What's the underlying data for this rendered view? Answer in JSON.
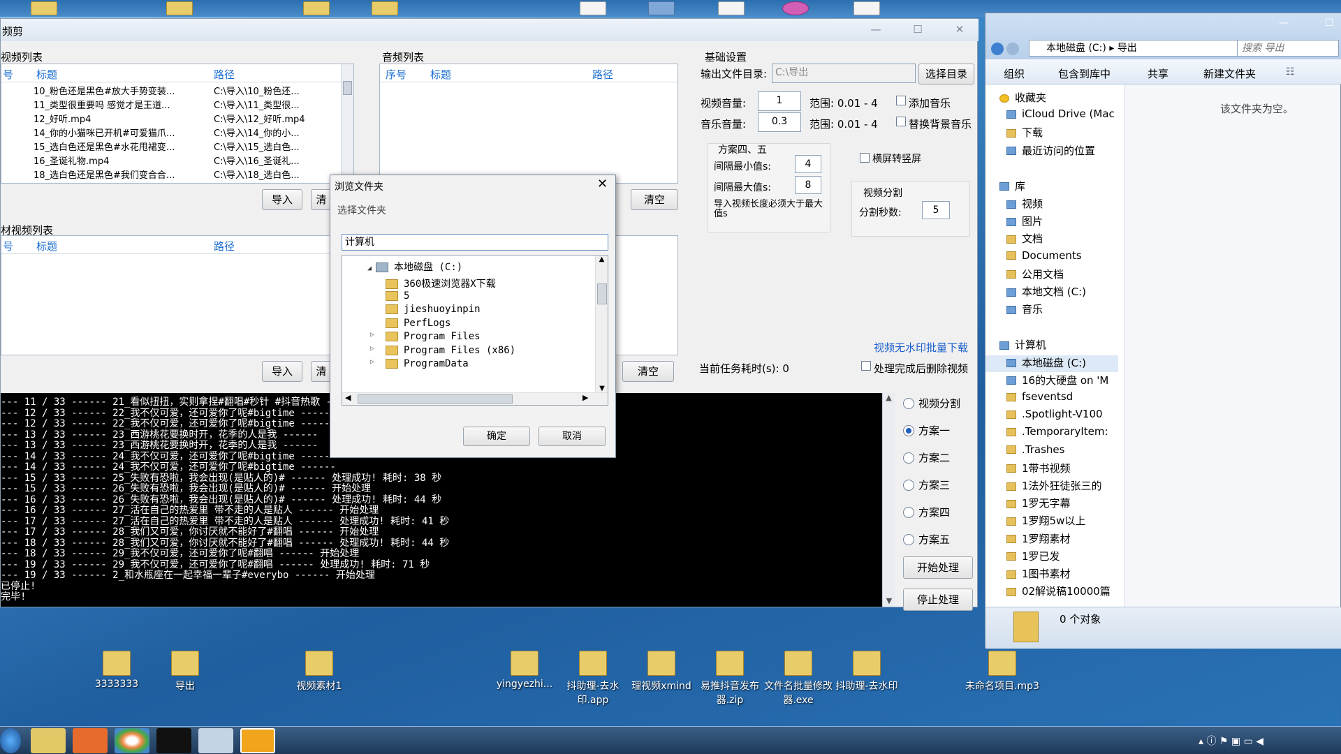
{
  "app": {
    "title": "频剪",
    "video_list": {
      "title": "视频列表",
      "cols": [
        "号",
        "标题",
        "路径"
      ],
      "rows": [
        {
          "title": "10_粉色还是黑色#放大手势变装...",
          "path": "C:\\导入\\10_粉色还..."
        },
        {
          "title": "11_类型很重要吗 感觉才是王道...",
          "path": "C:\\导入\\11_类型很..."
        },
        {
          "title": "12_好听.mp4",
          "path": "C:\\导入\\12_好听.mp4"
        },
        {
          "title": "14_你的小猫咪已开机#可爱猫爪...",
          "path": "C:\\导入\\14_你的小..."
        },
        {
          "title": "15_选白色还是黑色#水花甩裙变...",
          "path": "C:\\导入\\15_选白色..."
        },
        {
          "title": "16_圣诞礼物.mp4",
          "path": "C:\\导入\\16_圣诞礼..."
        },
        {
          "title": "18_选白色还是黑色#我们变合合...",
          "path": "C:\\导入\\18_选白色..."
        }
      ]
    },
    "audio_list": {
      "title": "音频列表",
      "cols": [
        "序号",
        "标题",
        "路径"
      ]
    },
    "material_list": {
      "title": "材视频列表",
      "cols": [
        "号",
        "标题",
        "路径"
      ]
    },
    "buttons": {
      "import": "导入",
      "clear": "清",
      "clear_full": "清空",
      "start": "开始处理",
      "stop": "停止处理",
      "choose_dir": "选择目录"
    },
    "settings": {
      "title": "基础设置",
      "output_label": "输出文件目录:",
      "output_value": "C:\\导出",
      "video_vol_label": "视频音量:",
      "video_vol": "1",
      "range1": "范围: 0.01 - 4",
      "add_music": "添加音乐",
      "music_vol_label": "音乐音量:",
      "music_vol": "0.3",
      "range2": "范围: 0.01 - 4",
      "replace_bg": "替换背景音乐",
      "plan45": "方案四、五",
      "min_label": "间隔最小值s:",
      "min_val": "4",
      "max_label": "间隔最大值s:",
      "max_val": "8",
      "note": "导入视频长度必须大于最大值s",
      "landscape": "横屏转竖屏",
      "split_title": "视频分割",
      "split_label": "分割秒数:",
      "split_val": "5",
      "link": "视频无水印批量下载",
      "elapsed": "当前任务耗时(s): 0",
      "delete_after": "处理完成后删除视频"
    },
    "modes": [
      "视频分割",
      "方案一",
      "方案二",
      "方案三",
      "方案四",
      "方案五"
    ],
    "selected_mode": "方案一",
    "console": [
      "--- 11 / 33 ------ 21_看似扭扭，实则拿捏#翻唱#秒针 #抖音热歌 ------",
      "--- 12 / 33 ------ 22_我不仅可爱，还可爱你了呢#bigtime ------",
      "--- 12 / 33 ------ 22_我不仅可爱，还可爱你了呢#bigtime ------",
      "--- 13 / 33 ------ 23_西游桃花要换时开，花季的人是我 ------",
      "--- 13 / 33 ------ 23_西游桃花要换时开，花季的人是我 ------",
      "--- 14 / 33 ------ 24_我不仅可爱，还可爱你了呢#bigtime ------",
      "--- 14 / 33 ------ 24_我不仅可爱，还可爱你了呢#bigtime ------",
      "--- 15 / 33 ------ 25_失败有恐啦，我会出现(是贴人的)# ------ 处理成功!  耗时: 38 秒",
      "--- 15 / 33 ------ 26_失败有恐啦，我会出现(是贴人的)# ------ 开始处理",
      "--- 16 / 33 ------ 26_失败有恐啦，我会出现(是贴人的)# ------ 处理成功!  耗时: 44 秒",
      "--- 16 / 33 ------ 27_活在自己的热爱里 带不走的人是贴人 ------ 开始处理",
      "--- 17 / 33 ------ 27_活在自己的热爱里 带不走的人是贴人 ------ 处理成功!  耗时: 41 秒",
      "--- 17 / 33 ------ 28_我们又可爱，你讨厌就不能好了#翻唱 ------ 开始处理",
      "--- 18 / 33 ------ 28_我们又可爱，你讨厌就不能好了#翻唱 ------ 处理成功!  耗时: 44 秒",
      "--- 18 / 33 ------ 29_我不仅可爱，还可爱你了呢#翻唱 ------ 开始处理",
      "--- 19 / 33 ------ 29_我不仅可爱，还可爱你了呢#翻唱 ------ 处理成功!  耗时: 71 秒",
      "--- 19 / 33 ------ 2_和水瓶座在一起幸福一辈子#everybo ------ 开始处理",
      "已停止!",
      "完毕!"
    ]
  },
  "dialog": {
    "title": "浏览文件夹",
    "prompt": "选择文件夹",
    "path": "计算机",
    "root": "本地磁盘 (C:)",
    "items": [
      "360极速浏览器X下载",
      "5",
      "jieshuoyinpin",
      "PerfLogs",
      "Program Files",
      "Program Files (x86)",
      "ProgramData"
    ],
    "ok": "确定",
    "cancel": "取消",
    "close": "✕"
  },
  "explorer": {
    "breadcrumb": [
      "本地磁盘 (C:)",
      "导出"
    ],
    "search_placeholder": "搜索 导出",
    "toolbar": [
      "组织",
      "包含到库中",
      "共享",
      "新建文件夹"
    ],
    "empty": "该文件夹为空。",
    "favorites": [
      "收藏夹",
      "iCloud Drive (Mac",
      "下载",
      "最近访问的位置"
    ],
    "libraries": [
      "库",
      "视频",
      "图片",
      "文档",
      "Documents",
      "公用文档",
      "本地文档 (C:)",
      "音乐"
    ],
    "computer": [
      "计算机",
      "本地磁盘 (C:)",
      "16的大硬盘 on 'M",
      "fseventsd",
      ".Spotlight-V100",
      ".TemporaryItem:",
      ".Trashes",
      "1带书视频",
      "1法外狂徒张三的",
      "1罗无字幕",
      "1罗翔5w以上",
      "1罗翔素材",
      "1罗已发",
      "1图书素材",
      "02解说稿10000篇"
    ],
    "status": "0 个对象"
  },
  "desktop": {
    "icons": [
      "3333333",
      "导出",
      "视频素材1",
      "yingyezhi...",
      "抖助理-去水印.app",
      "理视频xmind",
      "易推抖音发布器.zip",
      "文件名批量修改器.exe",
      "抖助理-去水印",
      "未命名项目.mp3"
    ]
  }
}
